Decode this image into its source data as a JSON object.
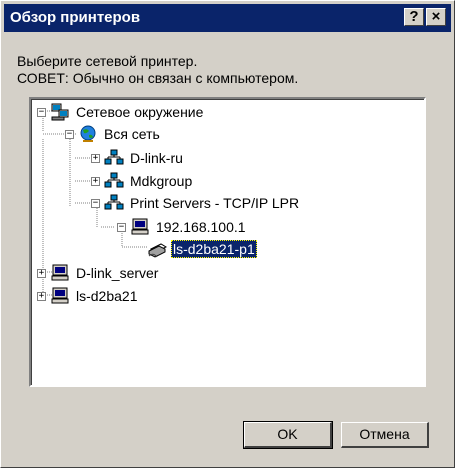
{
  "window": {
    "title": "Обзор принтеров",
    "help_button": "?",
    "close_button": "×"
  },
  "prompt": {
    "line1": "Выберите сетевой принтер.",
    "line2": "СОВЕТ: Обычно он связан с компьютером."
  },
  "tree": {
    "items": [
      {
        "label": "Сетевое окружение",
        "icon": "network-neighborhood-icon",
        "expander": "−"
      },
      {
        "label": "Вся сеть",
        "icon": "entire-network-globe-icon",
        "expander": "−"
      },
      {
        "label": "D-link-ru",
        "icon": "workgroup-icon",
        "expander": "+"
      },
      {
        "label": "Mdkgroup",
        "icon": "workgroup-icon",
        "expander": "+"
      },
      {
        "label": "Print Servers - TCP/IP LPR",
        "icon": "workgroup-icon",
        "expander": "−"
      },
      {
        "label": "192.168.100.1",
        "icon": "computer-icon",
        "expander": "−"
      },
      {
        "label": "ls-d2ba21-p1",
        "icon": "printer-icon",
        "expander": "",
        "selected": true
      },
      {
        "label": "D-link_server",
        "icon": "computer-icon",
        "expander": "+"
      },
      {
        "label": "ls-d2ba21",
        "icon": "computer-icon",
        "expander": "+"
      }
    ]
  },
  "buttons": {
    "ok": "OK",
    "cancel": "Отмена"
  },
  "colors": {
    "titlebar": "#0a246a",
    "dialog_face": "#d4d0c8",
    "selection": "#0a246a"
  }
}
